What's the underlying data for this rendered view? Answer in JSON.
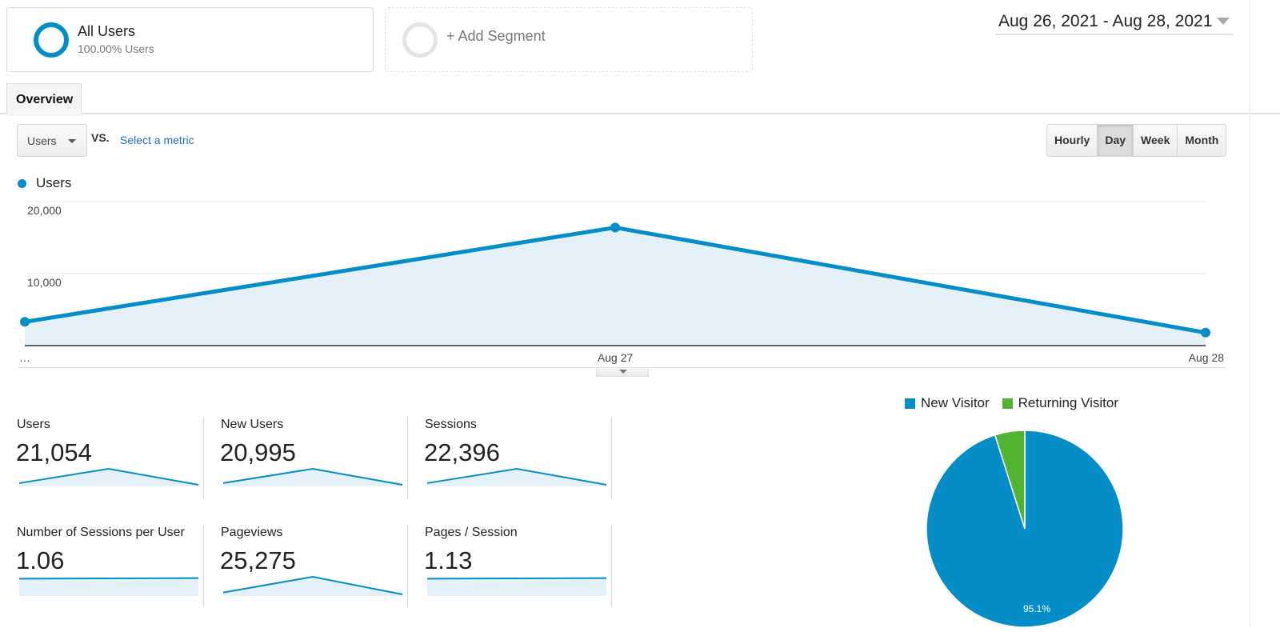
{
  "segments": {
    "all_users": {
      "title": "All Users",
      "subtitle": "100.00% Users"
    },
    "add_segment": {
      "label": "+ Add Segment"
    }
  },
  "date_range": {
    "label": "Aug 26, 2021 - Aug 28, 2021"
  },
  "tabs": [
    {
      "label": "Overview",
      "active": true
    }
  ],
  "chart_controls": {
    "metric_select": {
      "value": "Users"
    },
    "vs_label": "VS.",
    "select_metric_link": "Select a metric",
    "granularity": [
      {
        "label": "Hourly",
        "active": false
      },
      {
        "label": "Day",
        "active": true
      },
      {
        "label": "Week",
        "active": false
      },
      {
        "label": "Month",
        "active": false
      }
    ]
  },
  "colors": {
    "primary": "#058dc7",
    "secondary": "#50b432",
    "fill": "#e5f1f8"
  },
  "chart_data": [
    {
      "type": "area",
      "title": "",
      "legend": [
        "Users"
      ],
      "legend_position": "top-left",
      "x": [
        "…",
        "Aug 27",
        "Aug 28"
      ],
      "x_tick_labels": [
        "…",
        "Aug 27",
        "Aug 28"
      ],
      "series": [
        {
          "name": "Users",
          "values": [
            3300,
            16400,
            1800
          ]
        }
      ],
      "y_tick_labels": [
        "10,000",
        "20,000"
      ],
      "y_ticks": [
        10000,
        20000
      ],
      "ylim": [
        0,
        20000
      ],
      "grid": true,
      "xlabel": "",
      "ylabel": ""
    },
    {
      "type": "pie",
      "title": "",
      "legend_position": "top",
      "labels": [
        "New Visitor",
        "Returning Visitor"
      ],
      "values": [
        95.1,
        4.9
      ],
      "data_labels": [
        "95.1%",
        ""
      ],
      "colors": [
        "#058dc7",
        "#50b432"
      ]
    }
  ],
  "stats": [
    {
      "label": "Users",
      "value": "21,054",
      "sparkline": [
        3300,
        16400,
        1800
      ]
    },
    {
      "label": "New Users",
      "value": "20,995",
      "sparkline": [
        3300,
        16400,
        1750
      ]
    },
    {
      "label": "Sessions",
      "value": "22,396",
      "sparkline": [
        3500,
        17400,
        1900
      ]
    },
    {
      "label": "Number of Sessions per User",
      "value": "1.06",
      "sparkline": [
        1.05,
        1.06,
        1.07
      ]
    },
    {
      "label": "Pageviews",
      "value": "25,275",
      "sparkline": [
        4000,
        19500,
        2100
      ]
    },
    {
      "label": "Pages / Session",
      "value": "1.13",
      "sparkline": [
        1.11,
        1.13,
        1.15
      ]
    }
  ]
}
